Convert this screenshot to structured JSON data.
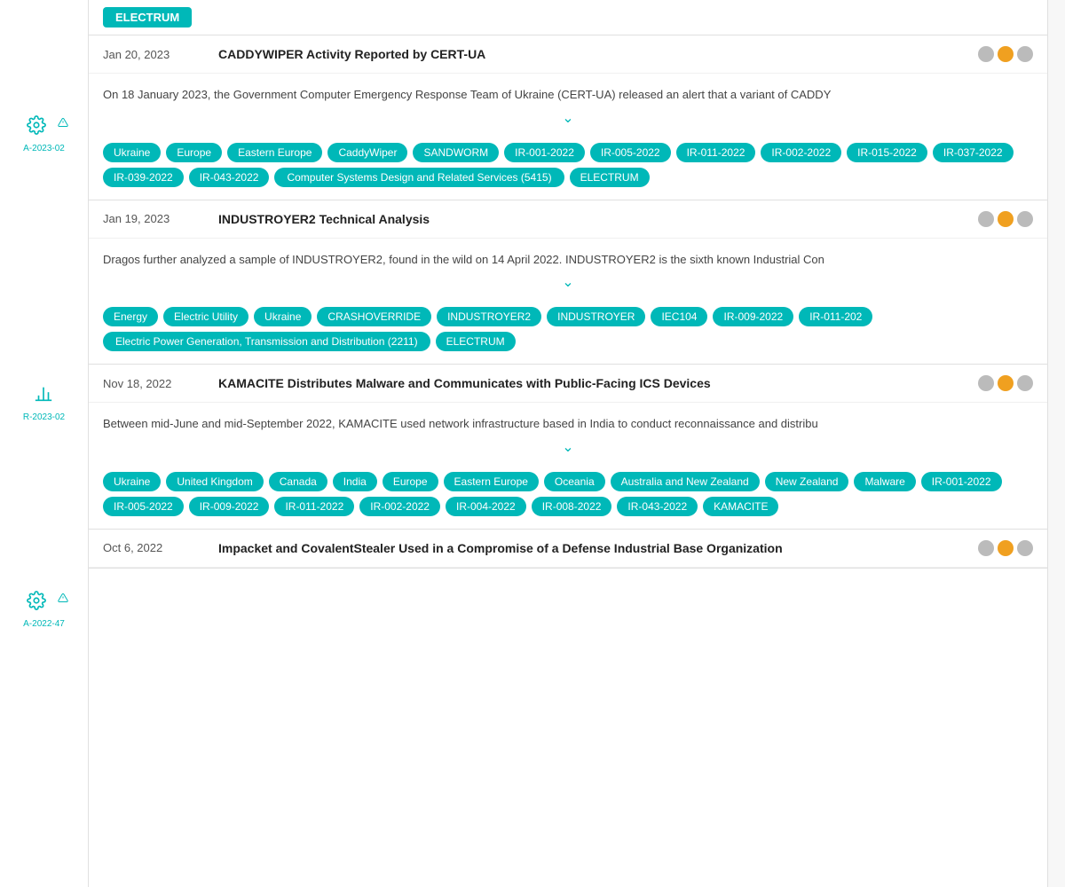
{
  "topButton": {
    "label": "ELECTRUM"
  },
  "sidebar": {
    "entries": [
      {
        "id": "entry-1",
        "iconType": "gear-warning",
        "label": "A-2023-02"
      },
      {
        "id": "entry-2",
        "iconType": "chart",
        "label": "R-2023-02"
      },
      {
        "id": "entry-3",
        "iconType": "gear-warning",
        "label": "A-2022-47"
      }
    ]
  },
  "reports": [
    {
      "id": "report-caddywiper",
      "date": "Jan 20, 2023",
      "title": "CADDYWIPER Activity Reported by CERT-UA",
      "indicators": [
        "gray",
        "orange",
        "gray"
      ],
      "body": "On 18 January 2023, the Government Computer Emergency Response Team of Ukraine (CERT-UA) released an alert that a variant of CADDY",
      "tags": [
        "Ukraine",
        "Europe",
        "Eastern Europe",
        "CaddyWiper",
        "SANDWORM",
        "IR-001-2022",
        "IR-005-2022",
        "IR-011-2022",
        "IR-002-2022",
        "IR-015-2022",
        "IR-037-2022",
        "IR-039-2022",
        "IR-043-2022",
        "Computer Systems Design and Related Services (5415)",
        "ELECTRUM"
      ]
    },
    {
      "id": "report-industroyer2",
      "date": "Jan 19, 2023",
      "title": "INDUSTROYER2 Technical Analysis",
      "indicators": [
        "gray",
        "orange",
        "gray"
      ],
      "body": "Dragos further analyzed a sample of INDUSTROYER2, found in the wild on 14 April 2022. INDUSTROYER2 is the sixth known Industrial Con",
      "tags": [
        "Energy",
        "Electric Utility",
        "Ukraine",
        "CRASHOVERRIDE",
        "INDUSTROYER2",
        "INDUSTROYER",
        "IEC104",
        "IR-009-2022",
        "IR-011-202",
        "Electric Power Generation, Transmission and Distribution (2211)",
        "ELECTRUM"
      ]
    },
    {
      "id": "report-kamacite",
      "date": "Nov 18, 2022",
      "title": "KAMACITE Distributes Malware and Communicates with Public-Facing ICS Devices",
      "indicators": [
        "gray",
        "orange",
        "gray"
      ],
      "body": "Between mid-June and mid-September 2022, KAMACITE used network infrastructure based in India to conduct reconnaissance and distribu",
      "tags": [
        "Ukraine",
        "United Kingdom",
        "Canada",
        "India",
        "Europe",
        "Eastern Europe",
        "Oceania",
        "Australia and New Zealand",
        "New Zealand",
        "Malware",
        "IR-001-2022",
        "IR-005-2022",
        "IR-009-2022",
        "IR-011-2022",
        "IR-002-2022",
        "IR-004-2022",
        "IR-008-2022",
        "IR-043-2022",
        "KAMACITE"
      ]
    },
    {
      "id": "report-impacket",
      "date": "Oct 6, 2022",
      "title": "Impacket and CovalentStealer Used in a Compromise of a Defense Industrial Base Organization",
      "indicators": [
        "gray",
        "orange",
        "gray"
      ],
      "body": "",
      "tags": []
    }
  ],
  "icons": {
    "gear_warning": "⚙",
    "chart": "📊",
    "chevron_down": "⌄"
  }
}
